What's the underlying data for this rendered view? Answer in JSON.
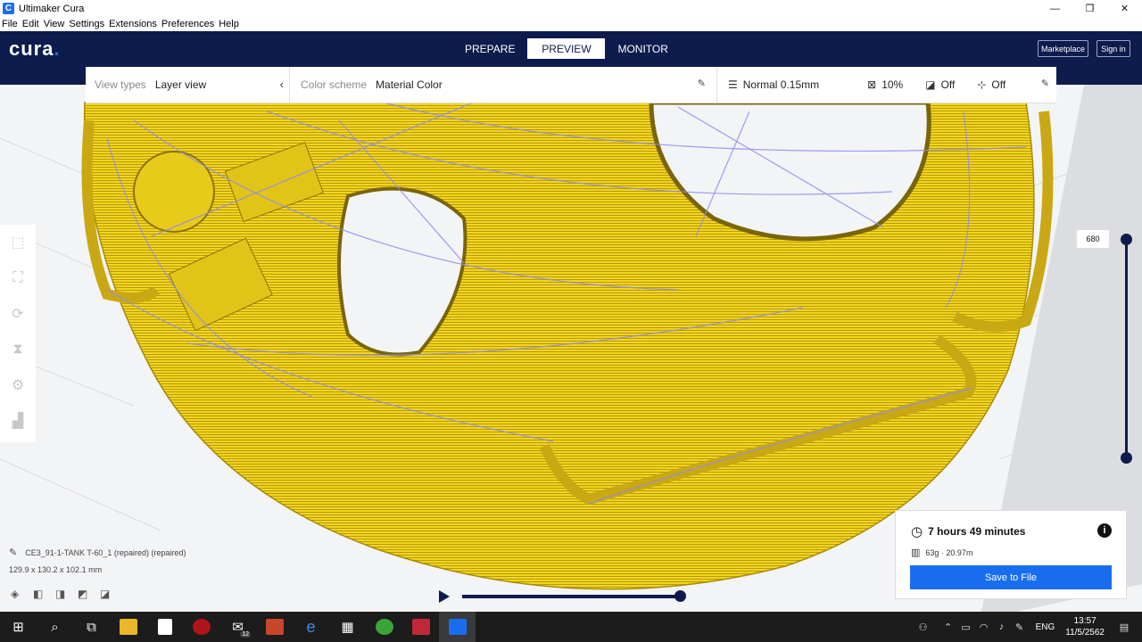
{
  "window": {
    "title": "Ultimaker Cura",
    "app_icon_letter": "C",
    "controls": [
      "—",
      "❐",
      "✕"
    ]
  },
  "menu": [
    "File",
    "Edit",
    "View",
    "Settings",
    "Extensions",
    "Preferences",
    "Help"
  ],
  "header": {
    "logo": "cura",
    "logo_dot": ".",
    "stages": [
      "PREPARE",
      "PREVIEW",
      "MONITOR"
    ],
    "active_stage": "PREVIEW",
    "marketplace_label": "Marketplace",
    "signin_label": "Sign in"
  },
  "toolbar": {
    "view_types_label": "View types",
    "view_type_value": "Layer view",
    "color_scheme_label": "Color scheme",
    "color_scheme_value": "Material Color",
    "profile": "Normal 0.15mm",
    "infill": "10%",
    "support": "Off",
    "adhesion": "Off"
  },
  "layer_slider": {
    "current_layer": "680"
  },
  "object": {
    "name": "CE3_91-1-TANK T-60_1 (repaired) (repaired)",
    "dimensions": "129.9 x 130.2 x 102.1 mm"
  },
  "print": {
    "time": "7 hours 49 minutes",
    "material": "63g · 20.97m",
    "save_label": "Save to File",
    "info_glyph": "i"
  },
  "taskbar": {
    "mail_badge": "12",
    "language": "ENG",
    "time": "13:57",
    "date": "11/5/2562"
  },
  "colors": {
    "header_bg": "#0e1b4d",
    "accent": "#196ef0",
    "model_yellow": "#f2d51e",
    "travel_lines": "#8c8cf0"
  }
}
